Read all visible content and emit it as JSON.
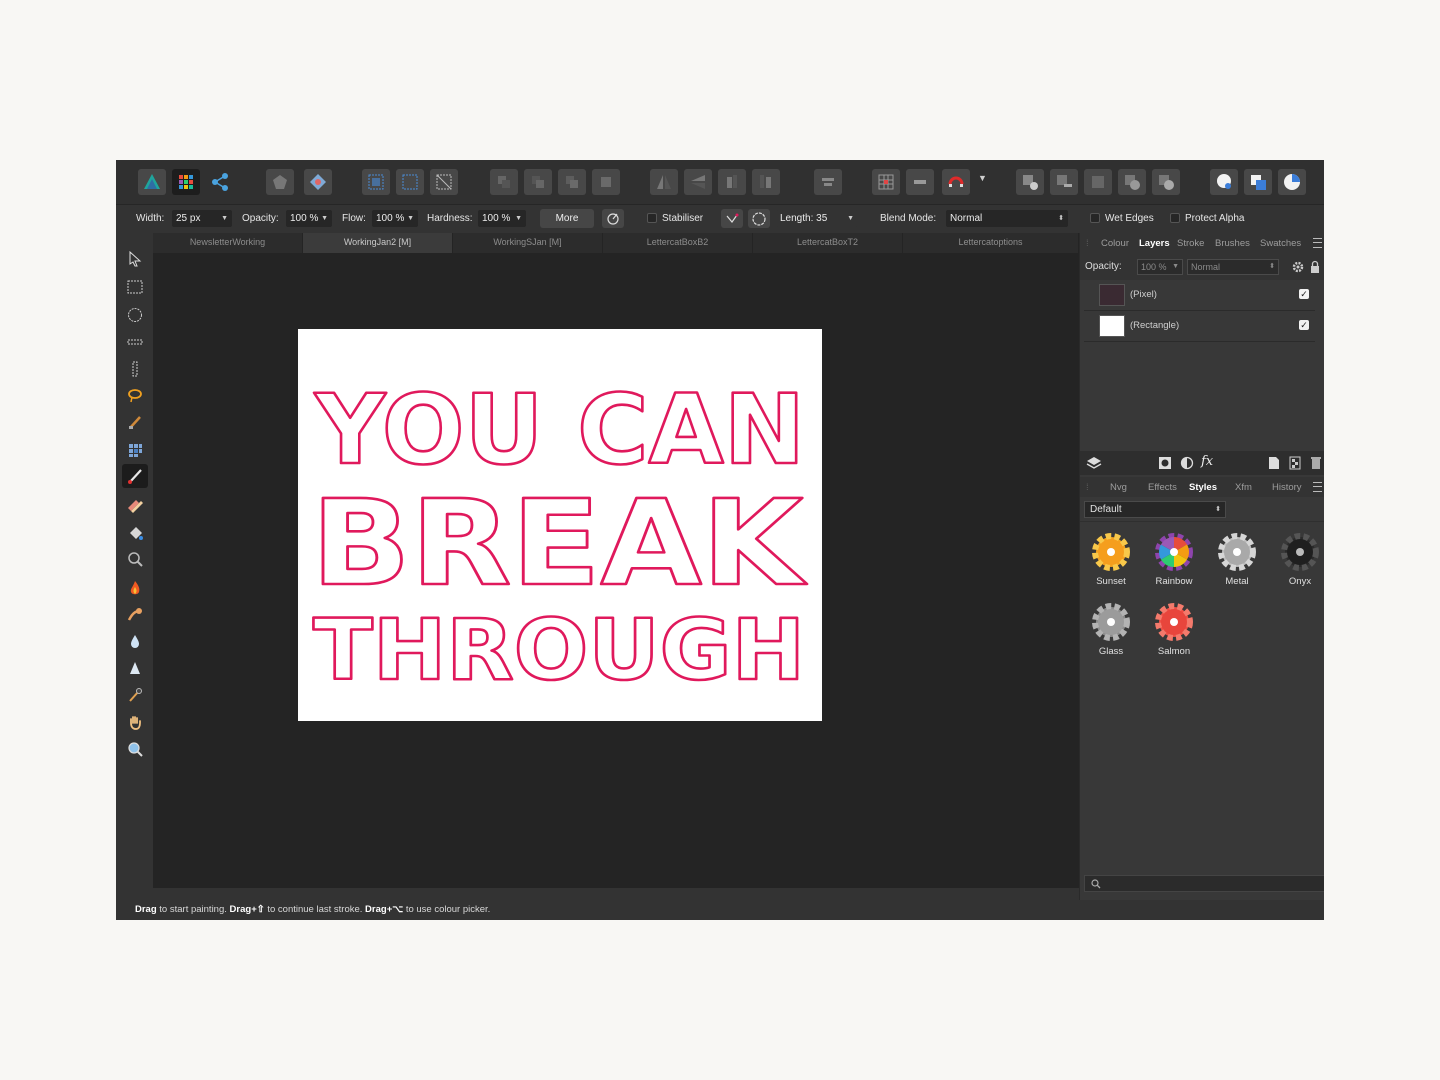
{
  "document_tabs": [
    "NewsletterWorking",
    "WorkingJan2 [M]",
    "WorkingSJan [M]",
    "LettercatBoxB2",
    "LettercatBoxT2",
    "Lettercatoptions"
  ],
  "context_toolbar": {
    "width_label": "Width:",
    "width_value": "25 px",
    "opacity_label": "Opacity:",
    "opacity_value": "100 %",
    "flow_label": "Flow:",
    "flow_value": "100 %",
    "hardness_label": "Hardness:",
    "hardness_value": "100 %",
    "more_label": "More",
    "stabiliser_label": "Stabiliser",
    "length_label": "Length: 35",
    "blend_label": "Blend Mode:",
    "blend_value": "Normal",
    "wet_edges_label": "Wet Edges",
    "protect_alpha_label": "Protect Alpha"
  },
  "panel_tabs_top": [
    "Colour",
    "Layers",
    "Stroke",
    "Brushes",
    "Swatches"
  ],
  "layers_options": {
    "opacity_label": "Opacity:",
    "opacity_value": "100 %",
    "blend_value": "Normal"
  },
  "layers": [
    {
      "name": "(Pixel)",
      "visible": true
    },
    {
      "name": "(Rectangle)",
      "visible": true
    }
  ],
  "layer_tools": {
    "fx_label": "fx"
  },
  "panel_tabs_bottom": [
    "Nvg",
    "Effects",
    "Styles",
    "Xfm",
    "History"
  ],
  "styles": {
    "category": "Default",
    "items": [
      {
        "name": "Sunset",
        "color": "#f5a623"
      },
      {
        "name": "Rainbow",
        "color": "#e33e8f"
      },
      {
        "name": "Metal",
        "color": "#b5b5b5"
      },
      {
        "name": "Onyx",
        "color": "#2a2a2a"
      },
      {
        "name": "Glass",
        "color": "#9a9a9a"
      },
      {
        "name": "Salmon",
        "color": "#ef5350"
      }
    ]
  },
  "canvas": {
    "lines": [
      "YOU CAN",
      "BREAK",
      "THROUGH"
    ],
    "stroke_color": "#e0195c"
  },
  "status": {
    "drag1": "Drag",
    "text1": "to start painting.",
    "drag2": "Drag+⇧",
    "text2": "to continue last stroke.",
    "drag3": "Drag+⌥",
    "text3": "to use colour picker."
  }
}
